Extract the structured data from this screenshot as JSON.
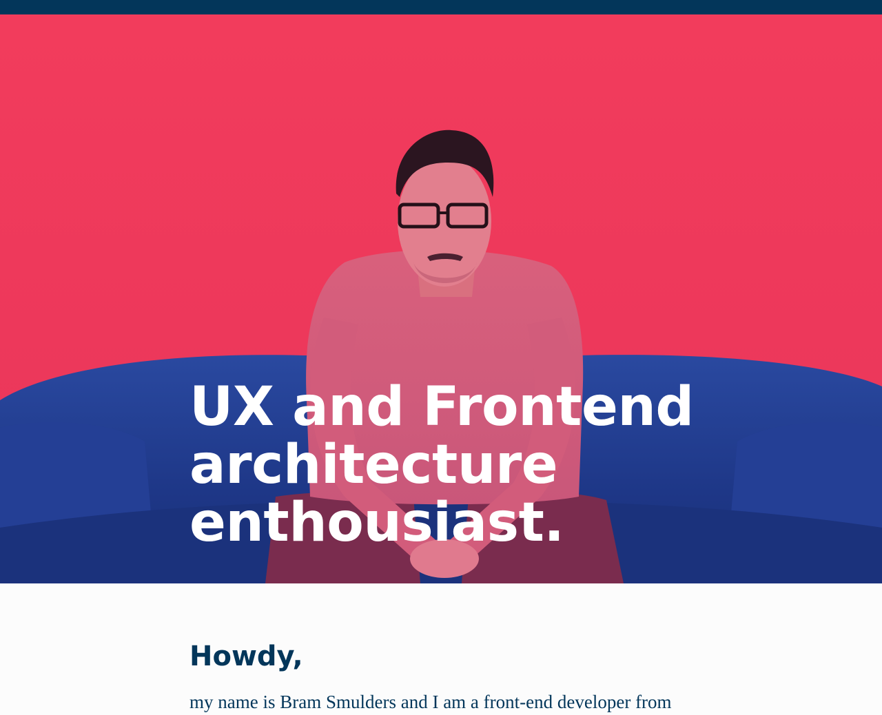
{
  "colors": {
    "topbar": "#03365a",
    "hero_background": "#f23c5c",
    "sofa": "#1f3a86",
    "text_dark": "#03365a",
    "text_light": "#ffffff"
  },
  "hero": {
    "image": "portrait-photo",
    "title_lines": [
      "UX and Frontend",
      "architecture",
      "enthousiast."
    ]
  },
  "intro": {
    "heading": "Howdy,",
    "text": "my name is Bram Smulders and I am a front-end developer from"
  }
}
